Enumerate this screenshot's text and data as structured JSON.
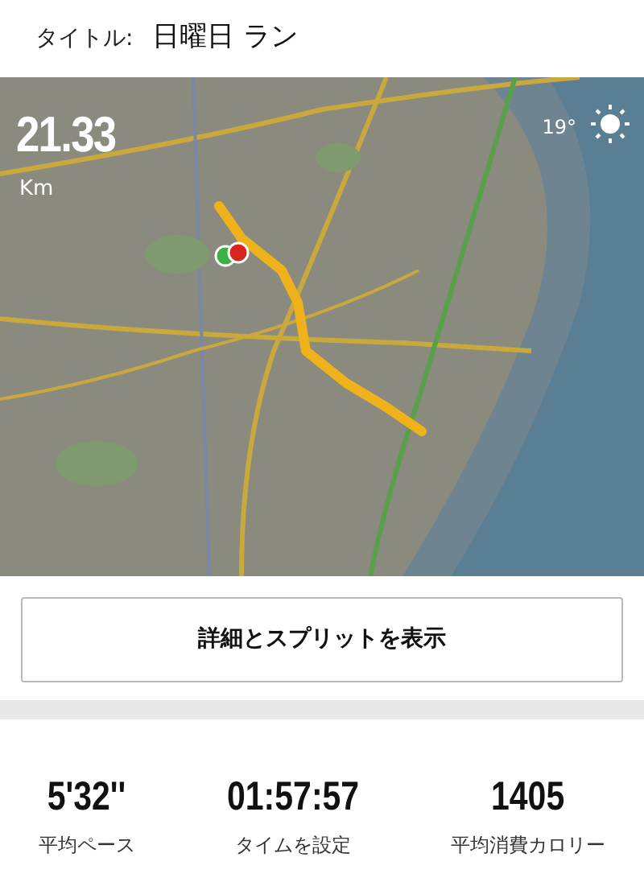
{
  "header": {
    "label": "タイトル:",
    "title": "日曜日 ラン"
  },
  "map": {
    "kind": "picture",
    "distance": "21.33",
    "unit": "Km",
    "temperature": "19°"
  },
  "details_button": "詳細とスプリットを表示",
  "stats": [
    {
      "value": "5'32''",
      "label": "平均ペース"
    },
    {
      "value": "01:57:57",
      "label": "タイムを設定"
    },
    {
      "value": "1405",
      "label": "平均消費カロリー"
    }
  ]
}
